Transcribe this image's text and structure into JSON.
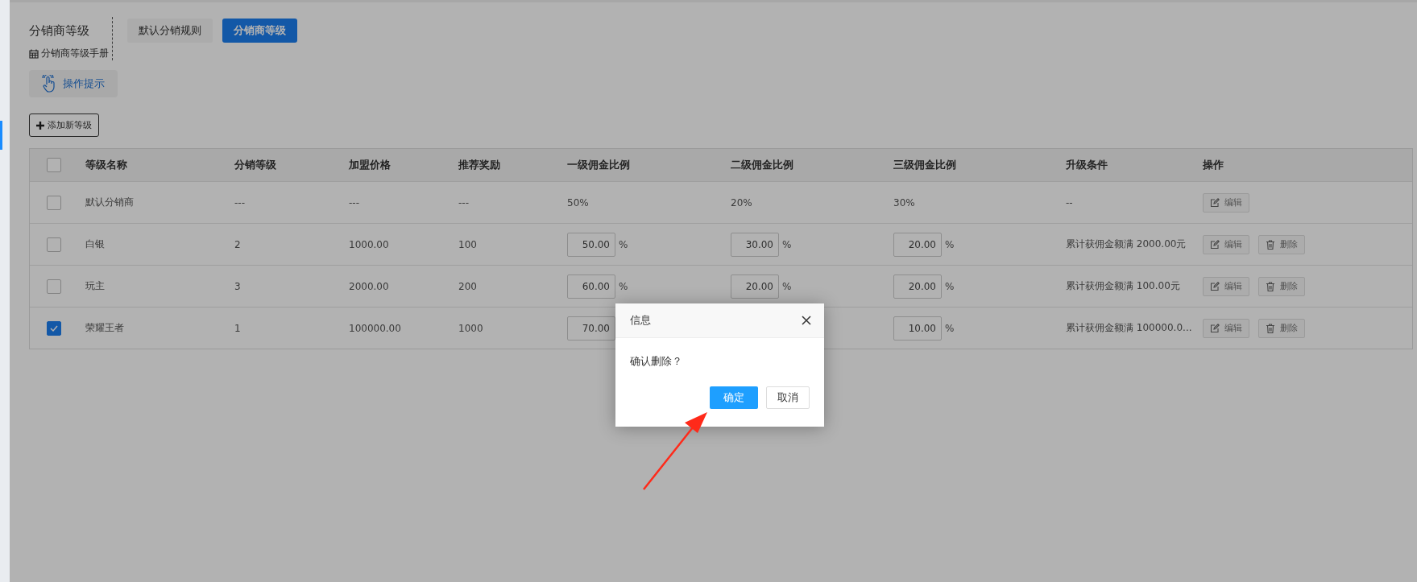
{
  "header": {
    "title": "分销商等级",
    "manual_link": "分销商等级手册"
  },
  "tabs": [
    {
      "label": "默认分销规则",
      "selected": false
    },
    {
      "label": "分销商等级",
      "selected": true
    }
  ],
  "hint_button": "操作提示",
  "add_button": "添加新等级",
  "table": {
    "header_checked": false,
    "columns": [
      "等级名称",
      "分销等级",
      "加盟价格",
      "推荐奖励",
      "一级佣金比例",
      "二级佣金比例",
      "三级佣金比例",
      "升级条件",
      "操作"
    ],
    "rows": [
      {
        "checked": false,
        "name": "默认分销商",
        "level": "---",
        "price": "---",
        "reward": "---",
        "rate1": {
          "kind": "text",
          "value": "50%"
        },
        "rate2": {
          "kind": "text",
          "value": "20%"
        },
        "rate3": {
          "kind": "text",
          "value": "30%"
        },
        "condition": "--",
        "actions": [
          {
            "kind": "edit",
            "label": "编辑"
          }
        ]
      },
      {
        "checked": false,
        "name": "白银",
        "level": "2",
        "price": "1000.00",
        "reward": "100",
        "rate1": {
          "kind": "input",
          "value": "50.00",
          "unit": "%"
        },
        "rate2": {
          "kind": "input",
          "value": "30.00",
          "unit": "%"
        },
        "rate3": {
          "kind": "input",
          "value": "20.00",
          "unit": "%"
        },
        "condition": "累计获佣金额满 2000.00元",
        "actions": [
          {
            "kind": "edit",
            "label": "编辑"
          },
          {
            "kind": "delete",
            "label": "删除"
          }
        ]
      },
      {
        "checked": false,
        "name": "玩主",
        "level": "3",
        "price": "2000.00",
        "reward": "200",
        "rate1": {
          "kind": "input",
          "value": "60.00",
          "unit": "%"
        },
        "rate2": {
          "kind": "input",
          "value": "20.00",
          "unit": "%"
        },
        "rate3": {
          "kind": "input",
          "value": "20.00",
          "unit": "%"
        },
        "condition": "累计获佣金额满 100.00元",
        "actions": [
          {
            "kind": "edit",
            "label": "编辑"
          },
          {
            "kind": "delete",
            "label": "删除"
          }
        ]
      },
      {
        "checked": true,
        "name": "荣耀王者",
        "level": "1",
        "price": "100000.00",
        "reward": "1000",
        "rate1": {
          "kind": "input",
          "value": "70.00"
        },
        "rate3": {
          "kind": "input",
          "value": "10.00",
          "unit": "%"
        },
        "condition": "累计获佣金额满 100000.0...",
        "actions": [
          {
            "kind": "edit",
            "label": "编辑"
          },
          {
            "kind": "delete",
            "label": "删除"
          }
        ]
      }
    ]
  },
  "dialog": {
    "title": "信息",
    "message": "确认删除？",
    "confirm": "确定",
    "cancel": "取消"
  }
}
